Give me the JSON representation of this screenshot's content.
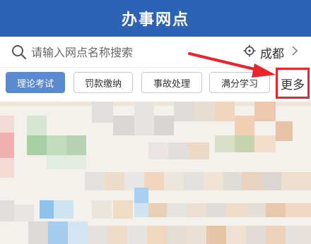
{
  "header": {
    "title": "办事网点"
  },
  "search": {
    "placeholder": "请输入网点名称搜索"
  },
  "location": {
    "city": "成都"
  },
  "tabs": [
    {
      "label": "理论考试",
      "active": true
    },
    {
      "label": "罚款缴纳",
      "active": false
    },
    {
      "label": "事故处理",
      "active": false
    },
    {
      "label": "满分学习",
      "active": false
    }
  ],
  "more": {
    "label": "更多"
  },
  "colors": {
    "header": "#2d63b6",
    "active_tab": "#5b8ad0",
    "highlight": "#e6262b"
  }
}
